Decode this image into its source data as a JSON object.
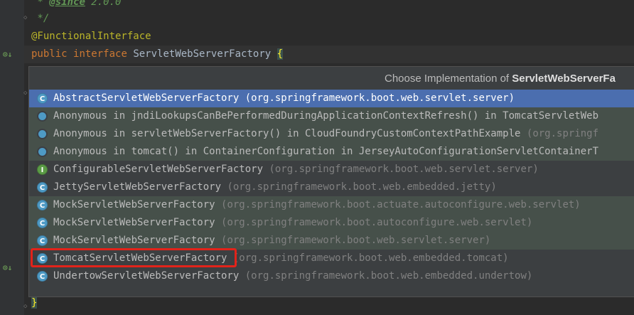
{
  "code": {
    "since_tag": "@since",
    "since_value": " 2.0.0",
    "doc_close": " */",
    "annotation": "@FunctionalInterface",
    "kw_public": "public",
    "kw_interface": "interface",
    "interface_name": "ServletWebServerFactory",
    "open_brace": "{",
    "close_brace": "}"
  },
  "popup": {
    "title_prefix": "Choose Implementation of ",
    "title_bold": "ServletWebServerFa",
    "items": [
      {
        "icon": "class-icon",
        "name": "AbstractServletWebServerFactory",
        "pkg": "(org.springframework.boot.web.servlet.server)"
      },
      {
        "icon": "anon-icon",
        "name": "Anonymous in jndiLookupsCanBePerformedDuringApplicationContextRefresh() in TomcatServletWeb",
        "pkg": ""
      },
      {
        "icon": "anon-icon",
        "name": "Anonymous in servletWebServerFactory() in CloudFoundryCustomContextPathExample",
        "pkg": "(org.springf"
      },
      {
        "icon": "anon-icon",
        "name": "Anonymous in tomcat() in ContainerConfiguration in JerseyAutoConfigurationServletContainerT",
        "pkg": ""
      },
      {
        "icon": "interface-icon",
        "name": "ConfigurableServletWebServerFactory",
        "pkg": "(org.springframework.boot.web.servlet.server)"
      },
      {
        "icon": "class-icon",
        "name": "JettyServletWebServerFactory",
        "pkg": "(org.springframework.boot.web.embedded.jetty)"
      },
      {
        "icon": "class-icon",
        "name": "MockServletWebServerFactory",
        "pkg": "(org.springframework.boot.actuate.autoconfigure.web.servlet)"
      },
      {
        "icon": "class-icon",
        "name": "MockServletWebServerFactory",
        "pkg": "(org.springframework.boot.autoconfigure.web.servlet)"
      },
      {
        "icon": "class-icon",
        "name": "MockServletWebServerFactory",
        "pkg": "(org.springframework.boot.web.servlet.server)"
      },
      {
        "icon": "class-icon",
        "name": "TomcatServletWebServerFactory",
        "pkg": "(org.springframework.boot.web.embedded.tomcat)"
      },
      {
        "icon": "class-icon",
        "name": "UndertowServletWebServerFactory",
        "pkg": "(org.springframework.boot.web.embedded.undertow)"
      }
    ]
  },
  "gutter": {
    "impl_marker_1": "⊙↓",
    "impl_marker_2": "⊙↓"
  },
  "icon_letters": {
    "class": "C",
    "interface": "I"
  }
}
